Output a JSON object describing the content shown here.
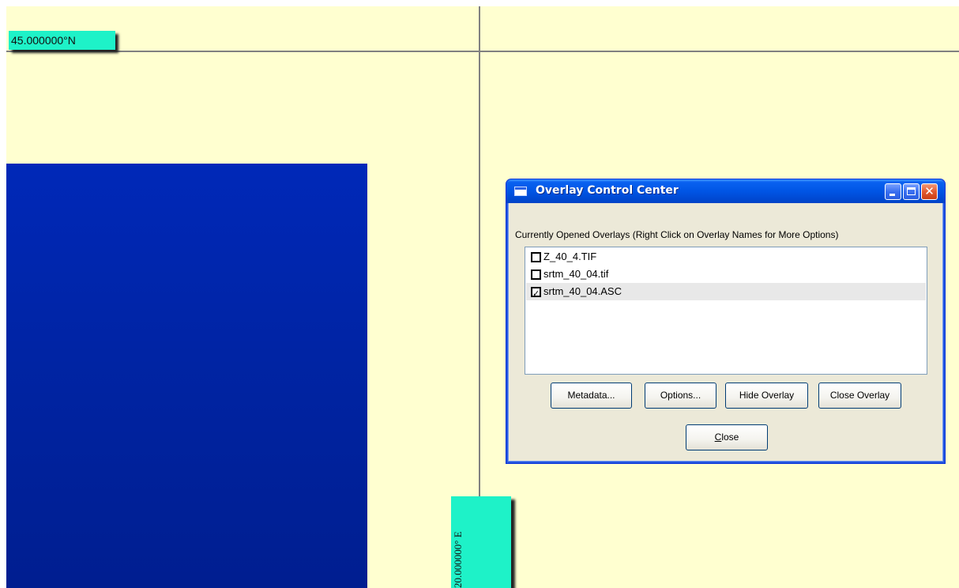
{
  "map": {
    "latitude_label": "45.000000°N",
    "longitude_label": "20.000000° E",
    "colors": {
      "background": "#ffffd0",
      "raster": "#0024a4",
      "label_bg": "#1ef2c8",
      "grid": "#808080"
    }
  },
  "window": {
    "title": "Overlay Control Center",
    "icon": "window-icon",
    "controls": [
      "minimize-icon",
      "maximize-icon",
      "close-icon"
    ],
    "overlays_label": "Currently Opened Overlays (Right Click on Overlay Names for More Options)",
    "overlays": [
      {
        "name": "Z_40_4.TIF",
        "checked": false
      },
      {
        "name": "srtm_40_04.tif",
        "checked": false
      },
      {
        "name": "srtm_40_04.ASC",
        "checked": true
      }
    ],
    "buttons": {
      "metadata": "Metadata...",
      "options": "Options...",
      "hide_overlay": "Hide Overlay",
      "close_overlay": "Close Overlay",
      "close_first": "C",
      "close_rest": "lose"
    }
  }
}
